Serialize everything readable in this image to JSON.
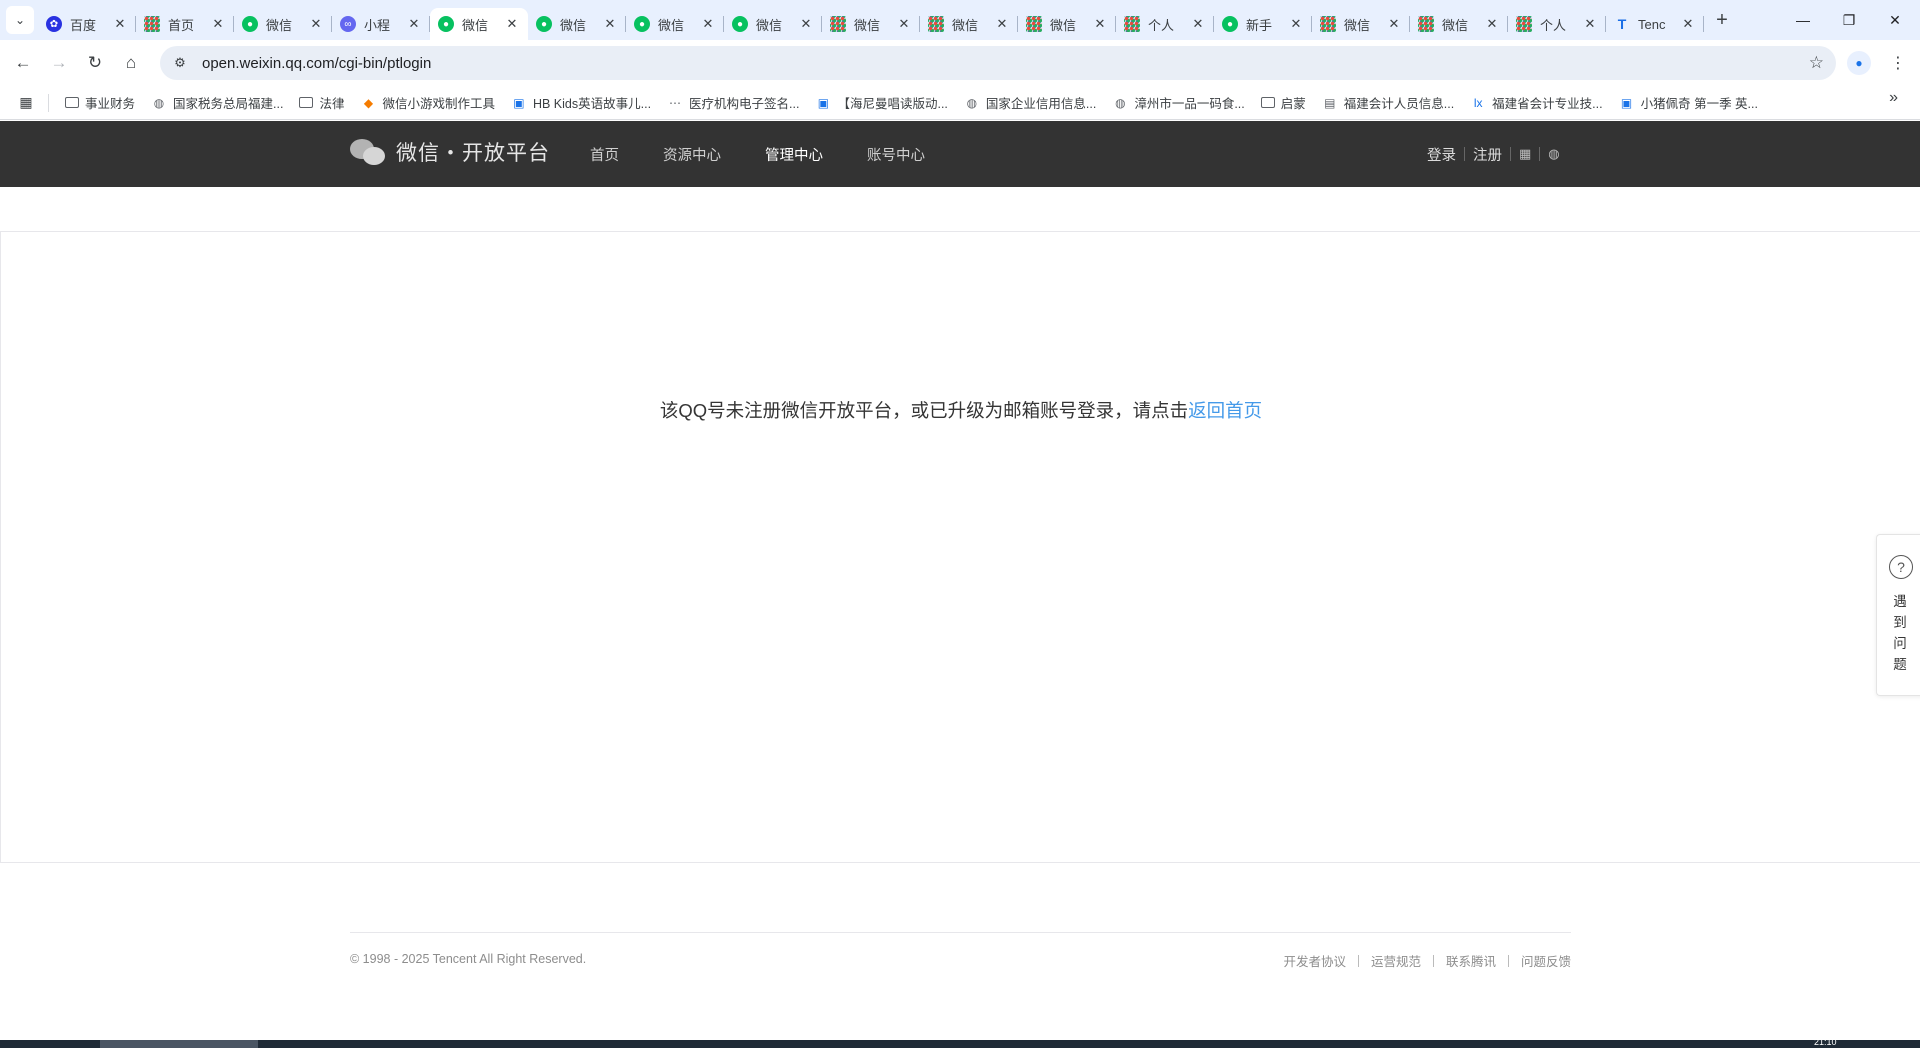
{
  "browser": {
    "tabs": [
      {
        "title": "百度",
        "icon": "baidu-icon",
        "active": false
      },
      {
        "title": "首页",
        "icon": "grid-icon",
        "active": false
      },
      {
        "title": "微信",
        "icon": "wechat-icon",
        "active": false
      },
      {
        "title": "小程",
        "icon": "miniprogram-icon",
        "active": false
      },
      {
        "title": "微信",
        "icon": "wechat-icon",
        "active": true
      },
      {
        "title": "微信",
        "icon": "wechat-icon",
        "active": false
      },
      {
        "title": "微信",
        "icon": "wechat-icon",
        "active": false
      },
      {
        "title": "微信",
        "icon": "wechat-icon",
        "active": false
      },
      {
        "title": "微信",
        "icon": "grid-icon",
        "active": false
      },
      {
        "title": "微信",
        "icon": "grid-icon",
        "active": false
      },
      {
        "title": "微信",
        "icon": "grid-icon",
        "active": false
      },
      {
        "title": "个人",
        "icon": "grid-icon",
        "active": false
      },
      {
        "title": "新手",
        "icon": "wechat-icon",
        "active": false
      },
      {
        "title": "微信",
        "icon": "grid-icon",
        "active": false
      },
      {
        "title": "微信",
        "icon": "grid-icon",
        "active": false
      },
      {
        "title": "个人",
        "icon": "grid-icon",
        "active": false
      },
      {
        "title": "Tenc",
        "icon": "tencent-icon",
        "active": false
      }
    ],
    "address": {
      "url": "open.weixin.qq.com/cgi-bin/ptlogin"
    },
    "bookmarks": [
      {
        "label": "事业财务",
        "icon": "folder-icon"
      },
      {
        "label": "国家税务总局福建...",
        "icon": "globe-icon"
      },
      {
        "label": "法律",
        "icon": "folder-icon"
      },
      {
        "label": "微信小游戏制作工具",
        "icon": "game-icon"
      },
      {
        "label": "HB Kids英语故事儿...",
        "icon": "bilibili-icon"
      },
      {
        "label": "医疗机构电子签名...",
        "icon": "site-icon"
      },
      {
        "label": "【海尼曼唱读版动...",
        "icon": "bilibili-icon"
      },
      {
        "label": "国家企业信用信息...",
        "icon": "globe-icon"
      },
      {
        "label": "漳州市一品一码食...",
        "icon": "globe-icon"
      },
      {
        "label": "启蒙",
        "icon": "folder-icon"
      },
      {
        "label": "福建会计人员信息...",
        "icon": "chart-icon"
      },
      {
        "label": "福建省会计专业技...",
        "icon": "lx-icon"
      },
      {
        "label": "小猪佩奇 第一季 英...",
        "icon": "bilibili-icon"
      }
    ]
  },
  "site": {
    "logo_text": "微信・开放平台",
    "nav": [
      {
        "label": "首页",
        "active": false
      },
      {
        "label": "资源中心",
        "active": false
      },
      {
        "label": "管理中心",
        "active": true
      },
      {
        "label": "账号中心",
        "active": false
      }
    ],
    "login_label": "登录",
    "register_label": "注册"
  },
  "main": {
    "message": "该QQ号未注册微信开放平台，或已升级为邮箱账号登录，请点击",
    "link_text": "返回首页"
  },
  "help": {
    "label_chars": [
      "遇",
      "到",
      "问",
      "题"
    ]
  },
  "footer": {
    "copyright": "© 1998 - 2025 Tencent All Right Reserved.",
    "links": [
      "开发者协议",
      "运营规范",
      "联系腾讯",
      "问题反馈"
    ]
  },
  "taskbar": {
    "clock": "21:10"
  }
}
